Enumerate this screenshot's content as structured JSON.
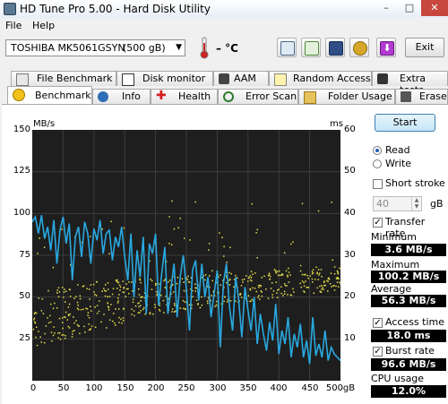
{
  "window": {
    "title": "HD Tune Pro 5.00 - Hard Disk Utility",
    "min": "–",
    "max": "□",
    "close": "✕"
  },
  "menu": {
    "file": "File",
    "help": "Help"
  },
  "toolbar": {
    "drive": "TOSHIBA MK5061GSYN",
    "size": "(500 gB)",
    "temperature": "– °C",
    "exit": "Exit",
    "icons": [
      "copy-info-icon",
      "copy-screenshot-icon",
      "save-icon",
      "options-icon",
      "download-icon"
    ]
  },
  "tabs_top": [
    {
      "label": "File Benchmark",
      "icon": "file-benchmark-icon"
    },
    {
      "label": "Disk monitor",
      "icon": "disk-monitor-icon"
    },
    {
      "label": "AAM",
      "icon": "speaker-icon"
    },
    {
      "label": "Random Access",
      "icon": "random-access-icon"
    },
    {
      "label": "Extra tests",
      "icon": "extra-tests-icon"
    }
  ],
  "tabs_bottom": [
    {
      "label": "Benchmark",
      "icon": "benchmark-icon",
      "active": true
    },
    {
      "label": "Info",
      "icon": "info-icon"
    },
    {
      "label": "Health",
      "icon": "health-icon"
    },
    {
      "label": "Error Scan",
      "icon": "error-scan-icon"
    },
    {
      "label": "Folder Usage",
      "icon": "folder-usage-icon"
    },
    {
      "label": "Erase",
      "icon": "erase-icon"
    }
  ],
  "controls": {
    "start": "Start",
    "read": "Read",
    "write": "Write",
    "mode": "read",
    "short_stroke": "Short stroke",
    "short_stroke_checked": false,
    "short_stroke_value": "40",
    "short_stroke_unit": "gB",
    "transfer_rate": "Transfer rate",
    "transfer_rate_checked": true,
    "access_time": "Access time",
    "access_time_checked": true,
    "burst_rate": "Burst rate",
    "burst_rate_checked": true
  },
  "stats": {
    "minimum_label": "Minimum",
    "minimum": "3.6 MB/s",
    "maximum_label": "Maximum",
    "maximum": "100.2 MB/s",
    "average_label": "Average",
    "average": "56.3 MB/s",
    "access_time": "18.0 ms",
    "burst_rate": "96.6 MB/s",
    "cpu_label": "CPU usage",
    "cpu": "12.0%"
  },
  "colors": {
    "line": "#29a8e0",
    "scatter": "#e8e04a",
    "chart_bg": "#1e1e1e",
    "grid": "#3c3c3c"
  },
  "chart_data": {
    "type": "line",
    "left_axis_label": "MB/s",
    "right_axis_label": "ms",
    "left_ylim": [
      0,
      150
    ],
    "right_ylim": [
      0,
      60
    ],
    "left_ticks": [
      "150",
      "125",
      "100",
      "75",
      "50",
      "25"
    ],
    "right_ticks": [
      "60",
      "50",
      "40",
      "30",
      "20",
      "10"
    ],
    "x_ticks": [
      "0",
      "50",
      "100",
      "150",
      "200",
      "250",
      "300",
      "350",
      "400",
      "450",
      "500gB"
    ],
    "xlim": [
      0,
      500
    ],
    "grid": true,
    "series": [
      {
        "type": "line",
        "x": [
          0,
          5,
          10,
          15,
          20,
          25,
          30,
          35,
          40,
          45,
          50,
          55,
          60,
          65,
          70,
          75,
          80,
          85,
          90,
          95,
          100,
          105,
          110,
          115,
          120,
          125,
          130,
          135,
          140,
          145,
          150,
          155,
          160,
          165,
          170,
          175,
          180,
          185,
          190,
          195,
          200,
          205,
          210,
          215,
          220,
          225,
          230,
          235,
          240,
          245,
          250,
          255,
          260,
          265,
          270,
          275,
          280,
          285,
          290,
          295,
          300,
          305,
          310,
          315,
          320,
          325,
          330,
          335,
          340,
          345,
          350,
          355,
          360,
          365,
          370,
          375,
          380,
          385,
          390,
          395,
          400,
          405,
          410,
          415,
          420,
          425,
          430,
          435,
          440,
          445,
          450,
          455,
          460,
          465,
          470,
          475,
          480,
          485,
          490,
          495,
          500
        ],
        "values": [
          95,
          98,
          88,
          99,
          85,
          92,
          78,
          96,
          70,
          90,
          98,
          82,
          94,
          60,
          86,
          92,
          74,
          95,
          88,
          70,
          91,
          84,
          96,
          76,
          88,
          90,
          72,
          86,
          80,
          92,
          74,
          60,
          88,
          50,
          78,
          62,
          86,
          40,
          82,
          76,
          88,
          45,
          64,
          80,
          40,
          55,
          70,
          38,
          62,
          75,
          55,
          30,
          66,
          72,
          48,
          70,
          50,
          62,
          38,
          52,
          66,
          20,
          58,
          70,
          44,
          30,
          62,
          48,
          26,
          56,
          42,
          30,
          50,
          22,
          40,
          28,
          18,
          35,
          24,
          46,
          16,
          30,
          22,
          38,
          14,
          28,
          20,
          34,
          14,
          24,
          10,
          38,
          15,
          22,
          14,
          30,
          12,
          20,
          16,
          14,
          12
        ],
        "unit": "MB/s"
      },
      {
        "type": "scatter",
        "unit": "ms",
        "note_cloud": [
          [
            0,
            8,
            22
          ],
          [
            100,
            12,
            24
          ],
          [
            200,
            16,
            25
          ],
          [
            300,
            18,
            26
          ],
          [
            400,
            20,
            27
          ],
          [
            500,
            22,
            28
          ]
        ]
      }
    ]
  }
}
